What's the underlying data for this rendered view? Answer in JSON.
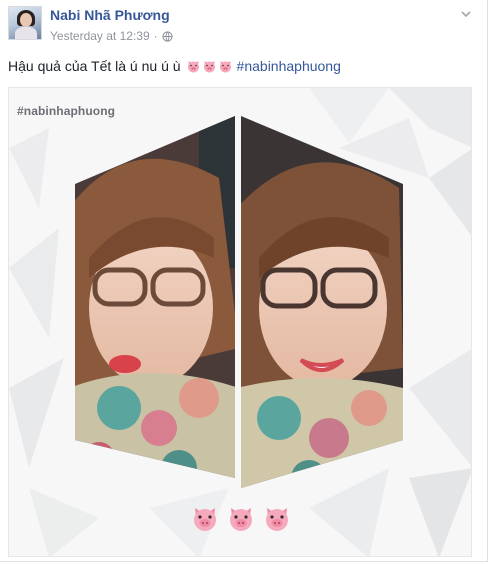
{
  "post": {
    "author": "Nabi Nhã Phương",
    "timestamp": "Yesterday at 12:39",
    "separator": "·",
    "audience_icon": "globe-icon",
    "text": "Hậu quả của Tết là ú nu ú ù",
    "emoji_count": 3,
    "emoji_icon": "pig-face-icon",
    "hashtag": "#nabinhaphuong"
  },
  "photo": {
    "watermark": "#nabinhaphuong",
    "bottom_emoji_count": 3
  },
  "colors": {
    "link": "#365899",
    "meta": "#90949c",
    "text": "#1d2129",
    "pig_pink": "#f5a9bd"
  }
}
